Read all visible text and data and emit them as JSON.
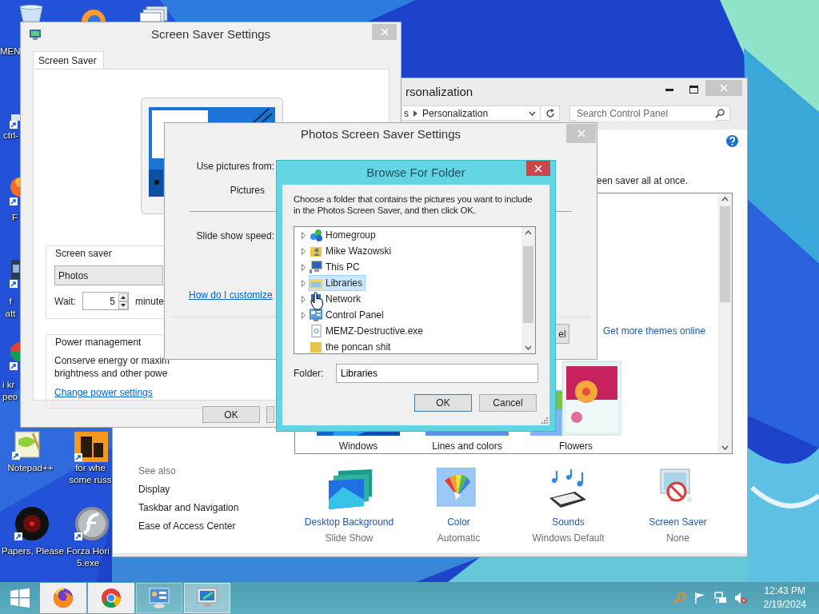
{
  "desktop_icons": [
    {
      "kind": "bin",
      "lines": [
        "MEN"
      ]
    },
    {
      "kind": "stub",
      "lines": [
        "ctrl-"
      ]
    },
    {
      "kind": "orange",
      "lines": [
        "F"
      ]
    },
    {
      "kind": "dark",
      "lines": [
        "f",
        "att"
      ]
    },
    {
      "kind": "tricolor",
      "lines": [
        "i kr",
        "peo"
      ]
    },
    {
      "kind": "notepad",
      "lines": [
        "Notepad++"
      ]
    },
    {
      "kind": "disc",
      "lines": [
        "Papers, Please"
      ]
    },
    {
      "kind": "orb"
    },
    {
      "kind": "stack"
    },
    {
      "kind": "doc",
      "lines": [
        "for whe",
        "some russ"
      ]
    },
    {
      "kind": "flash",
      "lines": [
        "Forza Hori",
        "5.exe"
      ]
    }
  ],
  "personalization_window": {
    "title": "rsonalization",
    "breadcrumb": [
      "s",
      "Personalization"
    ],
    "search": {
      "placeholder": "Search Control Panel"
    },
    "intro": "een saver all at once.",
    "themes_link": "Get more themes online",
    "themes": [
      {
        "kind": "windows",
        "label": "Windows"
      },
      {
        "kind": "lines",
        "label": "Lines and colors"
      },
      {
        "kind": "flowers",
        "label": "Flowers"
      }
    ],
    "see_also": {
      "heading": "See also",
      "links": [
        "Display",
        "Taskbar and Navigation",
        "Ease of Access Center"
      ]
    },
    "settings": [
      {
        "kind": "background",
        "label": "Desktop Background",
        "value": "Slide Show"
      },
      {
        "kind": "color",
        "label": "Color",
        "value": "Automatic"
      },
      {
        "kind": "sounds",
        "label": "Sounds",
        "value": "Windows Default"
      },
      {
        "kind": "screensaver",
        "label": "Screen Saver",
        "value": "None"
      }
    ]
  },
  "screen_saver_window": {
    "title": "Screen Saver Settings",
    "tabs": [
      {
        "label": "Screen Saver",
        "selected": true
      }
    ],
    "screen_saver_group": {
      "legend": "Screen saver",
      "value": "Photos",
      "wait_label": "Wait:",
      "wait_value": "5",
      "wait_unit": "minute"
    },
    "power_group": {
      "legend": "Power management",
      "lines": [
        "Conserve energy or maxim",
        "brightness and other powe"
      ],
      "link": "Change power settings"
    },
    "ok_button": "OK"
  },
  "photos_window": {
    "title": "Photos Screen Saver Settings",
    "source_label": "Use pictures from:",
    "source_value": "Pictures",
    "speed_label": "Slide show speed:",
    "help_link": "How do I customize",
    "cancel_button": "el"
  },
  "browse_window": {
    "title": "Browse For Folder",
    "description": "Choose a folder that contains the pictures you want to include in the Photos Screen Saver, and then click OK.",
    "tree": [
      {
        "kind": "homegroup",
        "label": "Homegroup",
        "expandable": true,
        "selected": false
      },
      {
        "kind": "user",
        "label": "Mike Wazowski",
        "expandable": true,
        "selected": false
      },
      {
        "kind": "pc",
        "label": "This PC",
        "expandable": true,
        "selected": false
      },
      {
        "kind": "libraries",
        "label": "Libraries",
        "expandable": true,
        "selected": true
      },
      {
        "kind": "network",
        "label": "Network",
        "expandable": true,
        "selected": false
      },
      {
        "kind": "control",
        "label": "Control Panel",
        "expandable": true,
        "selected": false
      },
      {
        "kind": "exe",
        "label": "MEMZ-Destructive.exe",
        "expandable": false,
        "selected": false
      },
      {
        "kind": "folder",
        "label": "the poncan shit",
        "expandable": false,
        "selected": false
      }
    ],
    "folder_label": "Folder:",
    "folder_value": "Libraries",
    "ok_button": "OK",
    "cancel_button": "Cancel"
  },
  "taskbar": {
    "apps": [
      {
        "kind": "fox",
        "running": false,
        "selected": false
      },
      {
        "kind": "chrome",
        "running": false,
        "selected": false
      },
      {
        "kind": "control",
        "running": true,
        "selected": false
      },
      {
        "kind": "monitor",
        "running": true,
        "selected": true
      }
    ],
    "tray": [
      {
        "kind": "search"
      },
      {
        "kind": "flag"
      },
      {
        "kind": "network"
      },
      {
        "kind": "mute"
      }
    ],
    "time": "12:43 PM",
    "date": "2/19/2024"
  }
}
